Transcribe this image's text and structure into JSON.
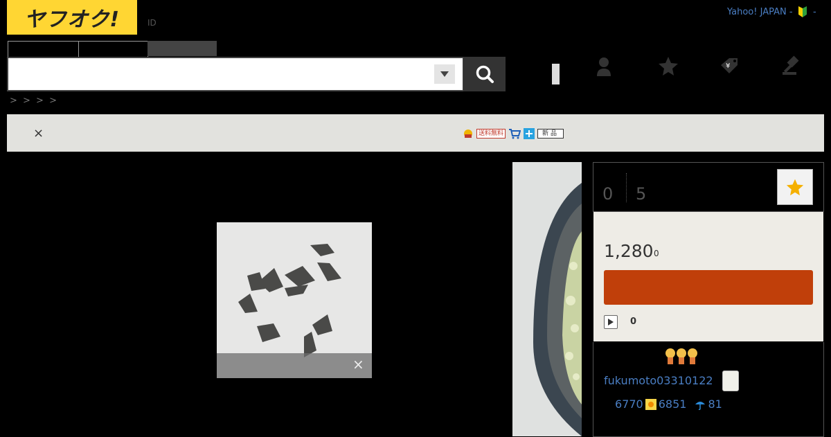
{
  "header": {
    "logo_text": "ヤフオク!",
    "id_label": "ID",
    "yahoo_link": "Yahoo! JAPAN -",
    "yahoo_suffix": "-"
  },
  "search": {
    "placeholder": "",
    "button_icon": "search-icon",
    "select_icon": "caret-down-icon"
  },
  "nav": {
    "icons": [
      "user-icon",
      "star-icon",
      "tag-icon",
      "gavel-icon"
    ]
  },
  "breadcrumb": "> > > >",
  "notice": {
    "close_label": "×",
    "badge_free_shipping": "送料無料",
    "badge_new": "新品"
  },
  "photo": {
    "close_label": "×"
  },
  "stats": {
    "watch_count": "0",
    "view_count": "5"
  },
  "price": {
    "amount": "1,280",
    "tax": "0",
    "bid_count": "0"
  },
  "seller": {
    "name": "fukumoto03310122",
    "rating_total": "6770",
    "rating_good": "6851",
    "rating_bad": "81"
  },
  "colors": {
    "brand_yellow": "#ffd633",
    "bid_button": "#c03f0a",
    "link": "#4a7ec3"
  }
}
